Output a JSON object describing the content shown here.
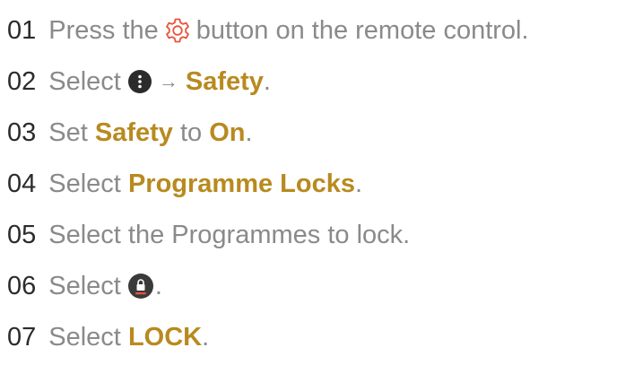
{
  "steps": [
    {
      "num": "01",
      "text_before": "Press the",
      "icon": "gear-icon",
      "text_after": "button on the remote control."
    },
    {
      "num": "02",
      "text_before": "Select",
      "icon": "more-options-icon",
      "arrow": "→",
      "highlight": "Safety",
      "text_after": "."
    },
    {
      "num": "03",
      "text_before": "Set",
      "highlight": "Safety",
      "text_middle": "to",
      "highlight2": "On",
      "text_after": "."
    },
    {
      "num": "04",
      "text_before": "Select",
      "highlight": "Programme Locks",
      "text_after": "."
    },
    {
      "num": "05",
      "text_before": "Select the Programmes to lock."
    },
    {
      "num": "06",
      "text_before": "Select",
      "icon": "lock-icon",
      "text_after": "."
    },
    {
      "num": "07",
      "text_before": "Select",
      "highlight": "LOCK",
      "text_after": "."
    }
  ],
  "colors": {
    "text": "#8a8a8a",
    "number": "#2b2b2b",
    "highlight": "#b88a1f",
    "gear_icon": "#e8533c",
    "icon_dark": "#2b2b2b",
    "lock_underline": "#e8533c"
  }
}
